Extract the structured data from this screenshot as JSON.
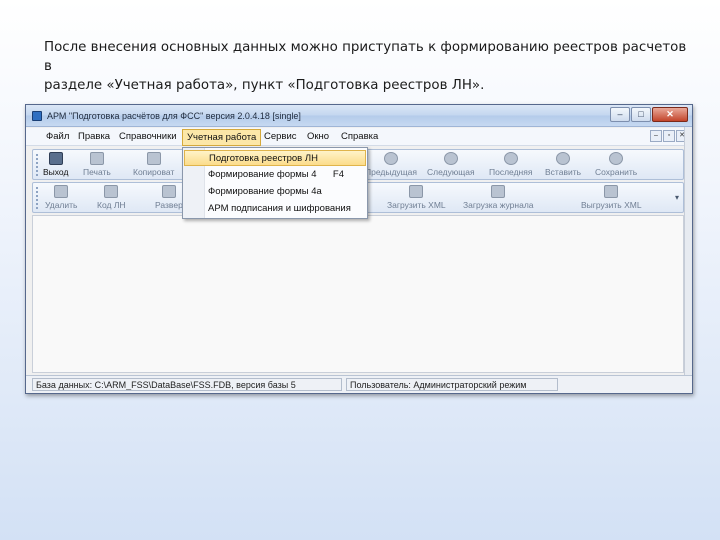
{
  "caption": {
    "line1": "После внесения основных данных можно приступать к формированию реестров расчетов в",
    "line2": "разделе «Учетная работа», пункт «Подготовка реестров ЛН»."
  },
  "window": {
    "title": "АРМ \"Подготовка расчётов для ФСС\" версия 2.0.4.18 [single]",
    "buttons": {
      "minimize": "‒",
      "maximize": "□",
      "close": "✕"
    }
  },
  "menu": [
    "Файл",
    "Правка",
    "Справочники",
    "Учетная работа",
    "Сервис",
    "Окно",
    "Справка"
  ],
  "toolbar1": [
    {
      "label": "Выход",
      "icon": "door-exit-icon"
    },
    {
      "label": "Печать",
      "icon": "printer-icon"
    },
    {
      "label": "Копироват",
      "icon": "copy-icon"
    },
    {
      "label": "Предыдущая",
      "icon": "previous-icon"
    },
    {
      "label": "Следующая",
      "icon": "next-icon"
    },
    {
      "label": "Последняя",
      "icon": "last-icon"
    },
    {
      "label": "Вставить",
      "icon": "insert-icon"
    },
    {
      "label": "Сохранить",
      "icon": "save-icon"
    }
  ],
  "toolbar2": [
    {
      "label": "Удалить",
      "icon": "delete-icon"
    },
    {
      "label": "Код ЛН",
      "icon": "barcode-icon"
    },
    {
      "label": "Развер",
      "icon": "expand-icon"
    },
    {
      "label": "Загрузить XML",
      "icon": "xml-load-icon"
    },
    {
      "label": "Загрузка журнала",
      "icon": "journal-load-icon"
    },
    {
      "label": "Выгрузить XML",
      "icon": "xml-export-icon"
    }
  ],
  "dropdown": [
    {
      "label": "Подготовка реестров ЛН",
      "shortcut": ""
    },
    {
      "label": "Формирование формы 4",
      "shortcut": "F4"
    },
    {
      "label": "Формирование формы 4а",
      "shortcut": ""
    },
    {
      "label": "АРМ подписания и шифрования",
      "shortcut": ""
    }
  ],
  "status": {
    "db": "База данных: C:\\ARM_FSS\\DataBase\\FSS.FDB, версия базы 5",
    "user": "Пользователь: Администраторский режим"
  }
}
